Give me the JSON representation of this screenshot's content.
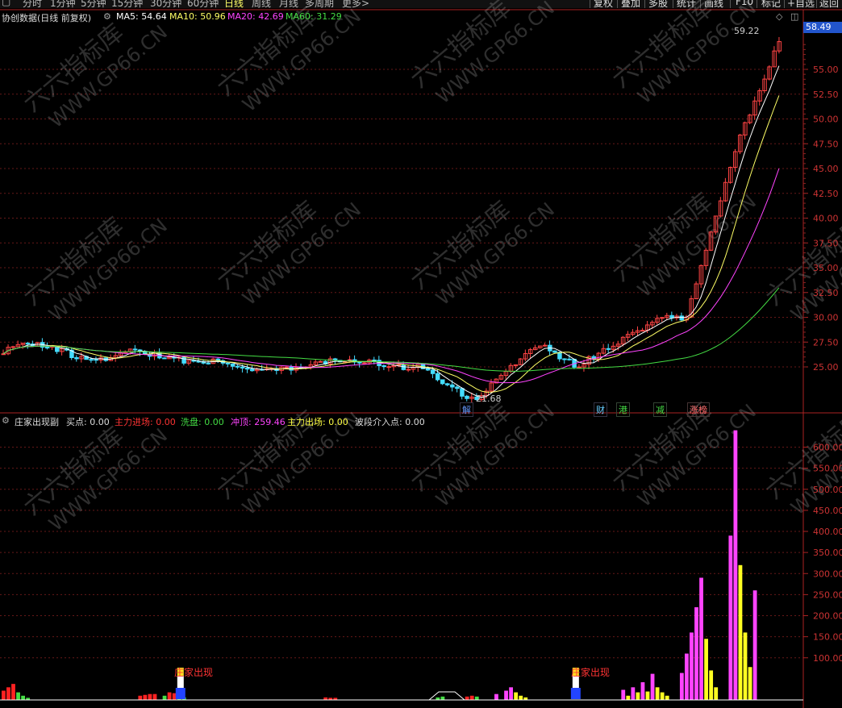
{
  "toolbar": {
    "periods": [
      "分时",
      "1分钟",
      "5分钟",
      "15分钟",
      "30分钟",
      "60分钟",
      "日线",
      "周线",
      "月线",
      "多周期",
      "更多>"
    ],
    "active_period": "日线",
    "buttons": [
      "复权",
      "叠加",
      "多股",
      "统计",
      "画线",
      "F10",
      "标记",
      "+自选",
      "返回"
    ]
  },
  "main_panel": {
    "title": "协创数据(日线 前复权)",
    "ma": [
      {
        "label": "MA5: 54.64",
        "color": "#ffffff"
      },
      {
        "label": "MA10: 50.96",
        "color": "#ffff66"
      },
      {
        "label": "MA20: 42.69",
        "color": "#ff44ff"
      },
      {
        "label": "MA60: 31.29",
        "color": "#44dd44"
      }
    ],
    "current_price": "58.49",
    "high_label": "59.22",
    "low_label": "21.68",
    "price_ticks": [
      "55.00",
      "52.50",
      "50.00",
      "47.50",
      "45.00",
      "42.50",
      "40.00",
      "37.50",
      "35.00",
      "32.50",
      "30.00",
      "27.50",
      "25.00"
    ],
    "event_tags": [
      {
        "text": "解",
        "color": "#6699ff"
      },
      {
        "text": "财",
        "color": "#66ccff"
      },
      {
        "text": "港",
        "color": "#44dd44"
      },
      {
        "text": "减",
        "color": "#44dd44"
      },
      {
        "text": "涨榜",
        "color": "#ff6666"
      }
    ]
  },
  "sub_panel": {
    "title": "庄家出现副",
    "indicators": [
      {
        "label": "买点: 0.00",
        "color": "#dddddd"
      },
      {
        "label": "主力进场: 0.00",
        "color": "#ff3333"
      },
      {
        "label": "洗盘: 0.00",
        "color": "#44dd44"
      },
      {
        "label": "冲顶: 259.46",
        "color": "#ff44ff"
      },
      {
        "label": "主力出场: 0.00",
        "color": "#ffff44"
      },
      {
        "label": "波段介入点: 0.00",
        "color": "#dddddd"
      }
    ],
    "ticks": [
      "600.00",
      "550.00",
      "500.00",
      "450.00",
      "400.00",
      "350.00",
      "300.00",
      "250.00",
      "200.00",
      "150.00",
      "100.00"
    ],
    "markers": [
      "庄家出现",
      "庄家出现"
    ]
  },
  "watermark": [
    "六六指标库",
    "WWW.GP66.CN"
  ]
}
